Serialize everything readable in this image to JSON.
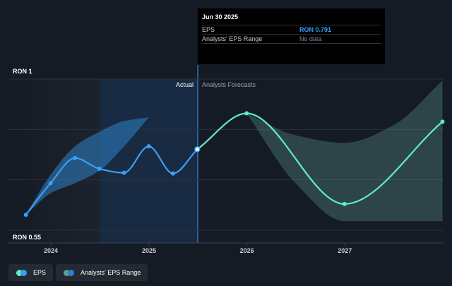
{
  "chart_data": {
    "type": "line",
    "y_unit": "RON",
    "ylim": [
      0.55,
      1
    ],
    "y_tick_labels": [
      "RON 1",
      "RON 0.55"
    ],
    "x_tick_labels": [
      "2024",
      "2025",
      "2026",
      "2027"
    ],
    "sections": {
      "actual_label": "Actual",
      "forecast_label": "Analysts Forecasts"
    },
    "series": [
      {
        "name": "EPS",
        "color": "#3a9ff5",
        "points": [
          {
            "x": "2023-09-30",
            "y": 0.596
          },
          {
            "x": "2023-12-31",
            "y": 0.69
          },
          {
            "x": "2024-03-31",
            "y": 0.765
          },
          {
            "x": "2024-06-30",
            "y": 0.733
          },
          {
            "x": "2024-09-30",
            "y": 0.721
          },
          {
            "x": "2024-12-31",
            "y": 0.8
          },
          {
            "x": "2025-03-31",
            "y": 0.719
          },
          {
            "x": "2025-06-30",
            "y": 0.791
          }
        ]
      },
      {
        "name": "EPS forecast",
        "color": "#5eead4",
        "points": [
          {
            "x": "2025-06-30",
            "y": 0.791
          },
          {
            "x": "2025-12-31",
            "y": 0.898
          },
          {
            "x": "2026-12-31",
            "y": 0.628
          },
          {
            "x": "2027-12-31",
            "y": 0.873
          }
        ]
      }
    ],
    "ranges": [
      {
        "name": "Analysts' EPS Range",
        "color": "#2f82c9",
        "x": [
          "2023-09-30",
          "2023-12-31",
          "2024-03-31",
          "2024-06-30",
          "2024-09-30",
          "2024-12-31"
        ],
        "high": [
          0.596,
          0.715,
          0.8,
          0.843,
          0.875,
          0.886
        ],
        "low": [
          0.596,
          0.66,
          0.69,
          0.727,
          0.8,
          0.886
        ]
      },
      {
        "name": "Analysts' EPS Range",
        "color": "#5f9e95",
        "x": [
          "2025-12-31",
          "2026-06-30",
          "2026-12-31",
          "2027-06-30",
          "2027-12-31"
        ],
        "high": [
          0.898,
          0.833,
          0.81,
          0.862,
          0.995
        ],
        "low": [
          0.898,
          0.691,
          0.577,
          0.577,
          0.577
        ]
      }
    ],
    "tooltip": {
      "date": "Jun 30 2025",
      "rows": [
        {
          "label": "EPS",
          "value": "RON 0.791"
        },
        {
          "label": "Analysts' EPS Range",
          "value": "No data"
        }
      ]
    },
    "legend": [
      "EPS",
      "Analysts' EPS Range"
    ],
    "grid": true
  }
}
